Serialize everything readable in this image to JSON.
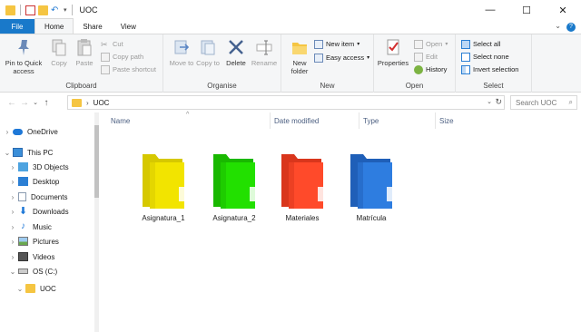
{
  "window": {
    "title": "UOC"
  },
  "ribbon_tabs": [
    "File",
    "Home",
    "Share",
    "View"
  ],
  "clipboard": {
    "pin": "Pin to Quick access",
    "copy": "Copy",
    "paste": "Paste",
    "cut": "Cut",
    "copy_path": "Copy path",
    "paste_shortcut": "Paste shortcut",
    "label": "Clipboard"
  },
  "organise": {
    "move_to": "Move to",
    "copy_to": "Copy to",
    "delete": "Delete",
    "rename": "Rename",
    "label": "Organise"
  },
  "new_group": {
    "new_folder": "New folder",
    "new_item": "New item",
    "easy_access": "Easy access",
    "label": "New"
  },
  "open_group": {
    "properties": "Properties",
    "open": "Open",
    "edit": "Edit",
    "history": "History",
    "label": "Open"
  },
  "select_group": {
    "select_all": "Select all",
    "select_none": "Select none",
    "invert": "Invert selection",
    "label": "Select"
  },
  "address": {
    "path": "UOC",
    "search_placeholder": "Search UOC"
  },
  "nav": [
    {
      "label": "OneDrive",
      "icon": "cloud-icon",
      "color": "#1e78d7"
    },
    {
      "label": "This PC",
      "icon": "computer-icon",
      "color": "#3b8fd9"
    },
    {
      "label": "3D Objects",
      "icon": "cube-icon",
      "color": "#4da3e0"
    },
    {
      "label": "Desktop",
      "icon": "desktop-icon",
      "color": "#2b7fd4"
    },
    {
      "label": "Documents",
      "icon": "document-icon",
      "color": "#8a9bb0"
    },
    {
      "label": "Downloads",
      "icon": "download-icon",
      "color": "#1e78d7"
    },
    {
      "label": "Music",
      "icon": "music-icon",
      "color": "#1e78d7"
    },
    {
      "label": "Pictures",
      "icon": "picture-icon",
      "color": "#6aa84f"
    },
    {
      "label": "Videos",
      "icon": "video-icon",
      "color": "#555555"
    },
    {
      "label": "OS (C:)",
      "icon": "drive-icon",
      "color": "#777777"
    },
    {
      "label": "UOC",
      "icon": "folder-icon",
      "color": "#f5c542"
    }
  ],
  "columns": [
    "Name",
    "Date modified",
    "Type",
    "Size"
  ],
  "folders": [
    {
      "name": "Asignatura_1",
      "color": "#f2e400",
      "shade": "#d6c800"
    },
    {
      "name": "Asignatura_2",
      "color": "#22e000",
      "shade": "#19b800"
    },
    {
      "name": "Materiales",
      "color": "#ff4a2a",
      "shade": "#d9361c"
    },
    {
      "name": "Matrícula",
      "color": "#2e7de0",
      "shade": "#1f5fb8"
    }
  ]
}
